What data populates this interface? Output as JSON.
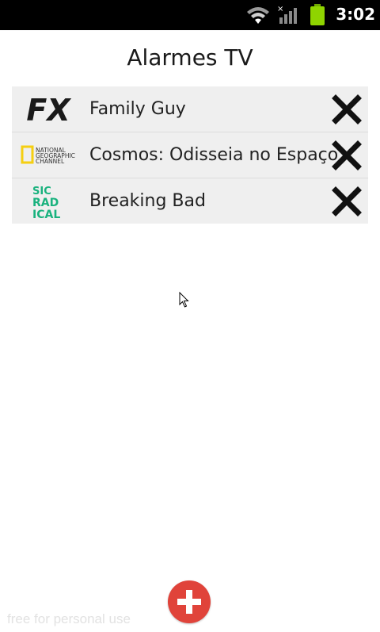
{
  "status_bar": {
    "time": "3:02",
    "icons": [
      "wifi-icon",
      "signal-icon",
      "battery-icon"
    ]
  },
  "page": {
    "title": "Alarmes TV"
  },
  "alarms": [
    {
      "channel": "FX",
      "channel_logo_icon": "fx-logo-icon",
      "show": "Family Guy"
    },
    {
      "channel": "NATIONAL GEOGRAPHIC CHANNEL",
      "channel_logo_icon": "natgeo-logo-icon",
      "show": "Cosmos: Odisseia no Espaço"
    },
    {
      "channel": "SIC RADICAL",
      "channel_logo_icon": "sic-radical-logo-icon",
      "show": "Breaking Bad"
    }
  ],
  "actions": {
    "delete_icon": "close-icon",
    "add_icon": "plus-icon"
  },
  "watermark": {
    "text": "free for personal use"
  },
  "colors": {
    "status_bar": "#000000",
    "row_background": "#efefef",
    "add_button": "#e0433a",
    "natgeo_yellow": "#f5cf12",
    "sic_radical_green": "#19b27e",
    "battery": "#8fd400"
  }
}
